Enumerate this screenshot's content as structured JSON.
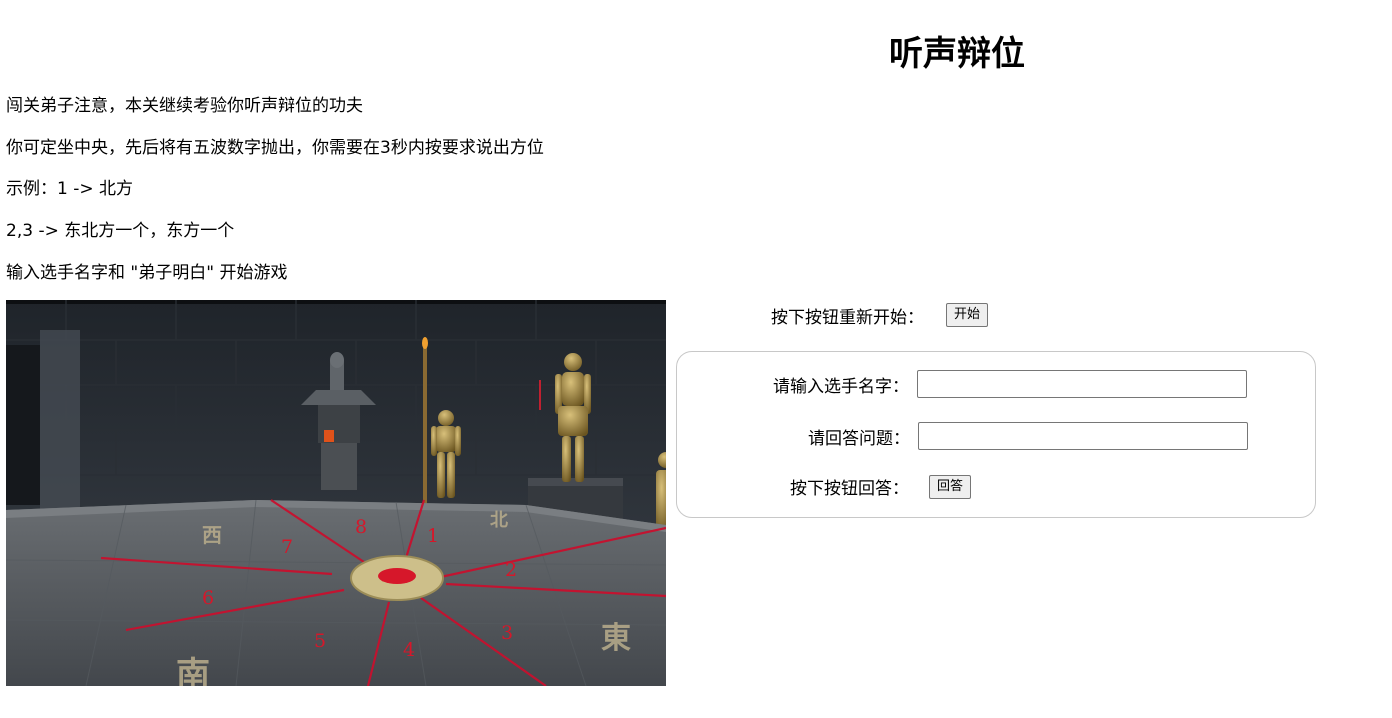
{
  "page": {
    "title": "听声辩位"
  },
  "intro": {
    "lines": [
      "闯关弟子注意，本关继续考验你听声辩位的功夫",
      "你可定坐中央，先后将有五波数字抛出，你需要在3秒内按要求说出方位",
      "示例：1 -> 北方",
      "2,3 -> 东北方一个，东方一个",
      "输入选手名字和 \"弟子明白\" 开始游戏"
    ]
  },
  "scene": {
    "direction_numbers": [
      "1",
      "2",
      "3",
      "4",
      "5",
      "6",
      "7",
      "8"
    ],
    "floor_characters": [
      "北",
      "東",
      "南",
      "西"
    ],
    "accent_color": "#d0182a"
  },
  "restart": {
    "label": "按下按钮重新开始：",
    "button_label": "开始"
  },
  "form": {
    "name_label": "请输入选手名字：",
    "name_value": "",
    "answer_label": "请回答问题：",
    "answer_value": "",
    "submit_label": "按下按钮回答：",
    "submit_button_label": "回答"
  }
}
